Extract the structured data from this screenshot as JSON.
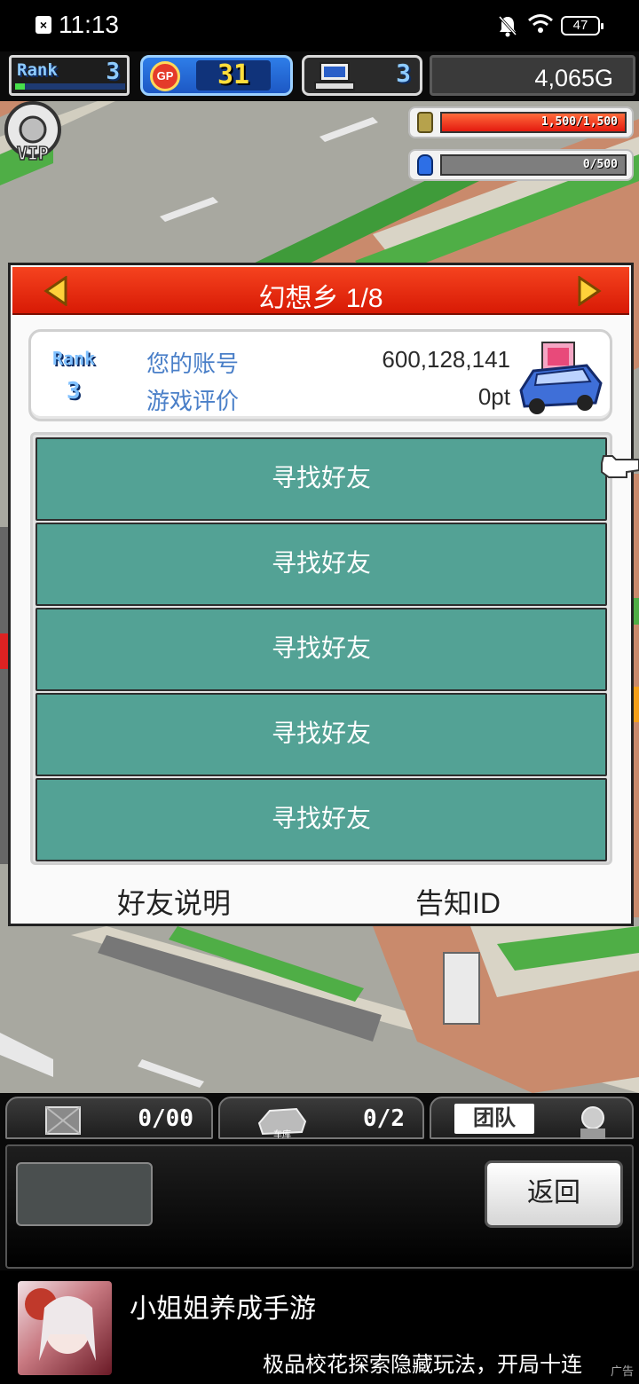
{
  "status_bar": {
    "time": "11:13",
    "battery": "47"
  },
  "hud": {
    "rank_label": "Rank",
    "rank_value": "3",
    "gp_label": "GP",
    "gp_value": "31",
    "computer_value": "3",
    "money": "4,065G"
  },
  "meters": {
    "money_meter": {
      "text": "1,500/1,500",
      "fraction": 1.0
    },
    "water_meter": {
      "text": "0/500",
      "fraction": 0.0
    }
  },
  "map": {
    "vip_label": "VIP"
  },
  "panel": {
    "title": "幻想乡 1/8",
    "rank_label": "Rank",
    "rank_value": "3",
    "account_label": "您的账号",
    "account_value": "600,128,141",
    "evaluation_label": "游戏评价",
    "evaluation_value": "0pt",
    "friend_slots": [
      "寻找好友",
      "寻找好友",
      "寻找好友",
      "寻找好友",
      "寻找好友"
    ],
    "friend_help": "好友说明",
    "tell_id": "告知ID"
  },
  "bottom": {
    "material_count": "0/00",
    "garage_label": "车库",
    "garage_count": "0/2",
    "team_label": "团队",
    "back_label": "返回"
  },
  "ad": {
    "title": "小姐姐养成手游",
    "description": "极品校花探索隐藏玩法，开局十连",
    "tag": "广告"
  },
  "colors": {
    "panel_header": "#e6290f",
    "friend_slot": "#53a295",
    "gp_blue": "#2468d8",
    "rank_blue": "#7fc0ff"
  }
}
